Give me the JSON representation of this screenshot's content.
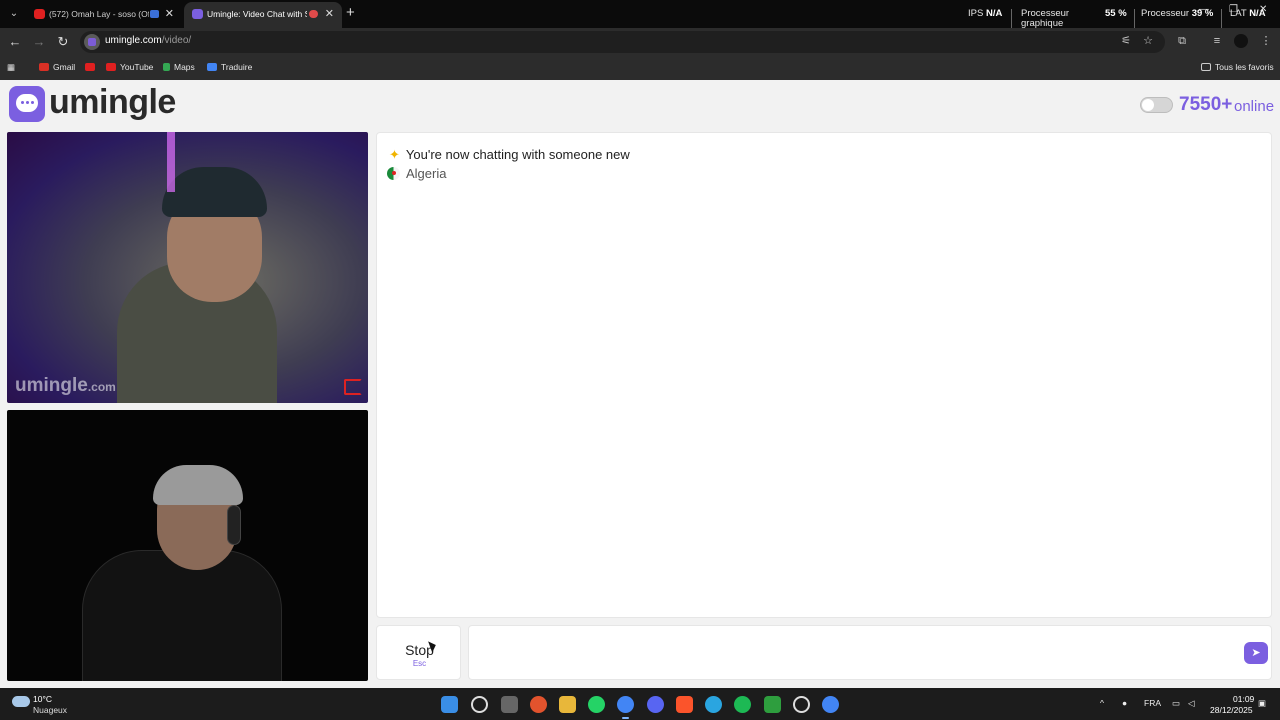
{
  "browser": {
    "tabs": [
      {
        "title": "(572) Omah Lay - soso (Offi",
        "favicon_color": "#e02020"
      },
      {
        "title": "Umingle: Video Chat with St",
        "favicon_color": "#7b5fe0"
      }
    ],
    "new_tab": "+",
    "perf": {
      "ips_label": "IPS",
      "ips_value": "N/A",
      "gpu_label_1": "Processeur",
      "gpu_label_2": "graphique",
      "gpu_value": "55 %",
      "cpu_label": "Processeur",
      "cpu_value": "39 %",
      "lat_label": "LAT",
      "lat_value": "N/A"
    },
    "url_host": "umingle.com",
    "url_path": "/video/",
    "bookmarks": [
      {
        "label": "Gmail",
        "color": "#d93025"
      },
      {
        "label": "",
        "color": "#e02020"
      },
      {
        "label": "YouTube",
        "color": "#e02020"
      },
      {
        "label": "Maps",
        "color": "#34a853"
      },
      {
        "label": "Traduire",
        "color": "#4285f4"
      }
    ],
    "all_bookmarks": "Tous les favoris"
  },
  "app": {
    "logo_text": "umingle",
    "online_count": "7550+",
    "online_label": "online",
    "accent_color": "#7b5fe0",
    "remote_video": {
      "watermark": "umingle",
      "watermark_suffix": ".com"
    },
    "chat": {
      "system_message": "You're now chatting with someone new",
      "country": "Algeria"
    },
    "stop_label": "Stop",
    "stop_key": "Esc",
    "message_placeholder": ""
  },
  "taskbar": {
    "weather_temp": "10°C",
    "weather_desc": "Nuageux",
    "language": "FRA",
    "time": "01:09",
    "date": "28/12/2025"
  }
}
